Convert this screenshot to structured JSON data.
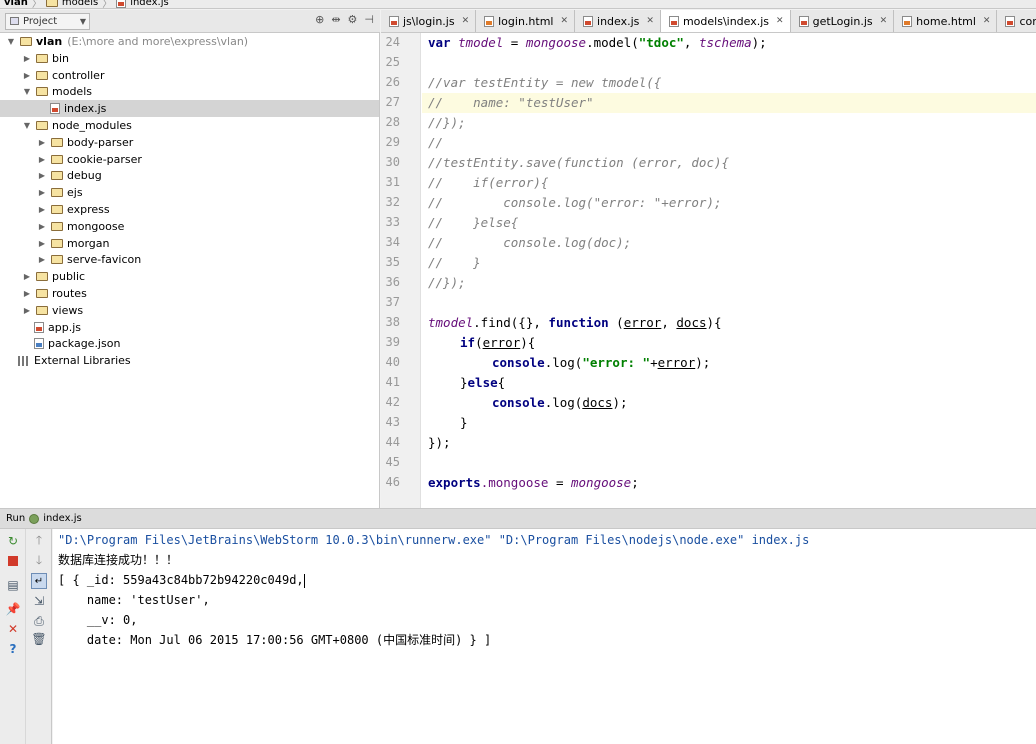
{
  "breadcrumb": [
    "vlan",
    "models",
    "index.js"
  ],
  "project_header": {
    "selector": "Project"
  },
  "tabs": [
    {
      "label": "js\\login.js",
      "type": "js",
      "active": false
    },
    {
      "label": "login.html",
      "type": "html",
      "active": false
    },
    {
      "label": "index.js",
      "type": "js",
      "active": false
    },
    {
      "label": "models\\index.js",
      "type": "js",
      "active": true
    },
    {
      "label": "getLogin.js",
      "type": "js",
      "active": false
    },
    {
      "label": "home.html",
      "type": "html",
      "active": false
    },
    {
      "label": "controller\\login.js",
      "type": "js",
      "active": false
    }
  ],
  "tree": {
    "root": {
      "label": "vlan",
      "path": "(E:\\more and more\\express\\vlan)"
    },
    "items": [
      {
        "label": "bin",
        "kind": "folder"
      },
      {
        "label": "controller",
        "kind": "folder"
      },
      {
        "label": "models",
        "kind": "folder"
      },
      {
        "label": "index.js",
        "kind": "js"
      },
      {
        "label": "node_modules",
        "kind": "folder"
      },
      {
        "label": "body-parser",
        "kind": "folder"
      },
      {
        "label": "cookie-parser",
        "kind": "folder"
      },
      {
        "label": "debug",
        "kind": "folder"
      },
      {
        "label": "ejs",
        "kind": "folder"
      },
      {
        "label": "express",
        "kind": "folder"
      },
      {
        "label": "mongoose",
        "kind": "folder"
      },
      {
        "label": "morgan",
        "kind": "folder"
      },
      {
        "label": "serve-favicon",
        "kind": "folder"
      },
      {
        "label": "public",
        "kind": "folder"
      },
      {
        "label": "routes",
        "kind": "folder"
      },
      {
        "label": "views",
        "kind": "folder"
      },
      {
        "label": "app.js",
        "kind": "js"
      },
      {
        "label": "package.json",
        "kind": "json"
      },
      {
        "label": "External Libraries",
        "kind": "lib"
      }
    ],
    "selected": "index.js"
  },
  "editor": {
    "line_numbers": [
      "24",
      "25",
      "26",
      "27",
      "28",
      "29",
      "30",
      "31",
      "32",
      "33",
      "34",
      "35",
      "36",
      "37",
      "38",
      "39",
      "40",
      "41",
      "42",
      "43",
      "44",
      "45",
      "46"
    ],
    "line24": {
      "kw": "var",
      "v1": "tmodel",
      "eq": " = ",
      "obj": "mongoose",
      "call": ".model(",
      "str": "\"tdoc\"",
      "comma": ", ",
      "v2": "tschema",
      "end": ");"
    },
    "line26": "//var testEntity = new tmodel({",
    "line27": "//    name: \"testUser\"",
    "line28": "//});",
    "line29": "//",
    "line30": "//testEntity.save(function (error, doc){",
    "line31": "//    if(error){",
    "line32": "//        console.log(\"error: \"+error);",
    "line33": "//    }else{",
    "line34": "//        console.log(doc);",
    "line35": "//    }",
    "line36": "//});",
    "line38": {
      "obj": "tmodel",
      "find": ".find({}, ",
      "kw": "function",
      "open": " (",
      "p1": "error",
      "comma": ", ",
      "p2": "docs",
      "close": "){"
    },
    "line39": {
      "kw": "if",
      "open": "(",
      "p": "error",
      "close": "){"
    },
    "line40": {
      "fn": "console",
      "call": ".log(",
      "str": "\"error: \"",
      "plus": "+",
      "p": "error",
      "end": ");"
    },
    "line41": {
      "close": "}",
      "kw": "else",
      "open": "{"
    },
    "line42": {
      "fn": "console",
      "call": ".log(",
      "p": "docs",
      "end": ");"
    },
    "line43": "}",
    "line44": "});",
    "line46": {
      "obj": "exports",
      "prop": ".mongoose",
      "eq": " = ",
      "val": "mongoose",
      "end": ";"
    }
  },
  "run": {
    "title": "Run",
    "file": "index.js",
    "console": {
      "cmd": "\"D:\\Program Files\\JetBrains\\WebStorm 10.0.3\\bin\\runnerw.exe\" \"D:\\Program Files\\nodejs\\node.exe\" index.js",
      "line1": "数据库连接成功！！！",
      "line2": "[ { _id: 559a43c84bb72b94220c049d,",
      "line3": "    name: 'testUser',",
      "line4": "    __v: 0,",
      "line5": "    date: Mon Jul 06 2015 17:00:56 GMT+0800 (中国标准时间) } ]"
    }
  }
}
